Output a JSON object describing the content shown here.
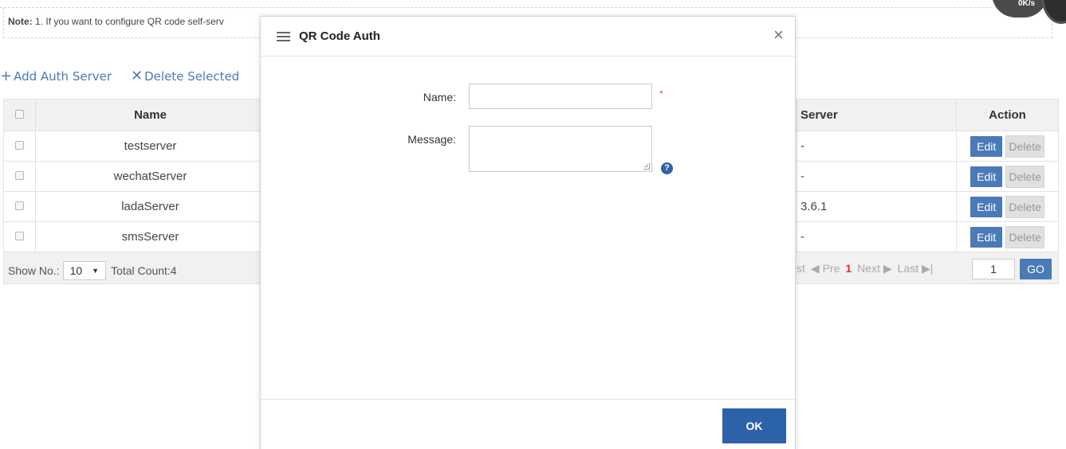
{
  "note": {
    "label": "Note:",
    "text": "1. If you want to configure QR code self-serv"
  },
  "gauge_text": "0K/s",
  "toolbar": {
    "add_label": "Add Auth Server",
    "delete_label": "Delete Selected"
  },
  "table": {
    "headers": {
      "name": "Name",
      "server": "Server",
      "action": "Action"
    },
    "rows": [
      {
        "name": "testserver",
        "server": "-"
      },
      {
        "name": "wechatServer",
        "server": "-"
      },
      {
        "name": "ladaServer",
        "server": "3.6.1"
      },
      {
        "name": "smsServer",
        "server": "-"
      }
    ],
    "edit_label": "Edit",
    "delete_label": "Delete"
  },
  "footer": {
    "show_label": "Show No.:",
    "page_size": "10",
    "total": "Total Count:4",
    "first_partial": "st",
    "pre": "Pre",
    "current_page": "1",
    "next": "Next",
    "last": "Last",
    "page_input": "1",
    "go": "GO"
  },
  "modal": {
    "title": "QR Code Auth",
    "name_label": "Name:",
    "name_value": "",
    "required_mark": "*",
    "message_label": "Message:",
    "message_value": "",
    "help_glyph": "?",
    "ok_label": "OK"
  },
  "colors": {
    "accent": "#4a7ab8",
    "modal_primary": "#2c62a8",
    "required": "#e0503a",
    "current_page": "#d9302b"
  }
}
